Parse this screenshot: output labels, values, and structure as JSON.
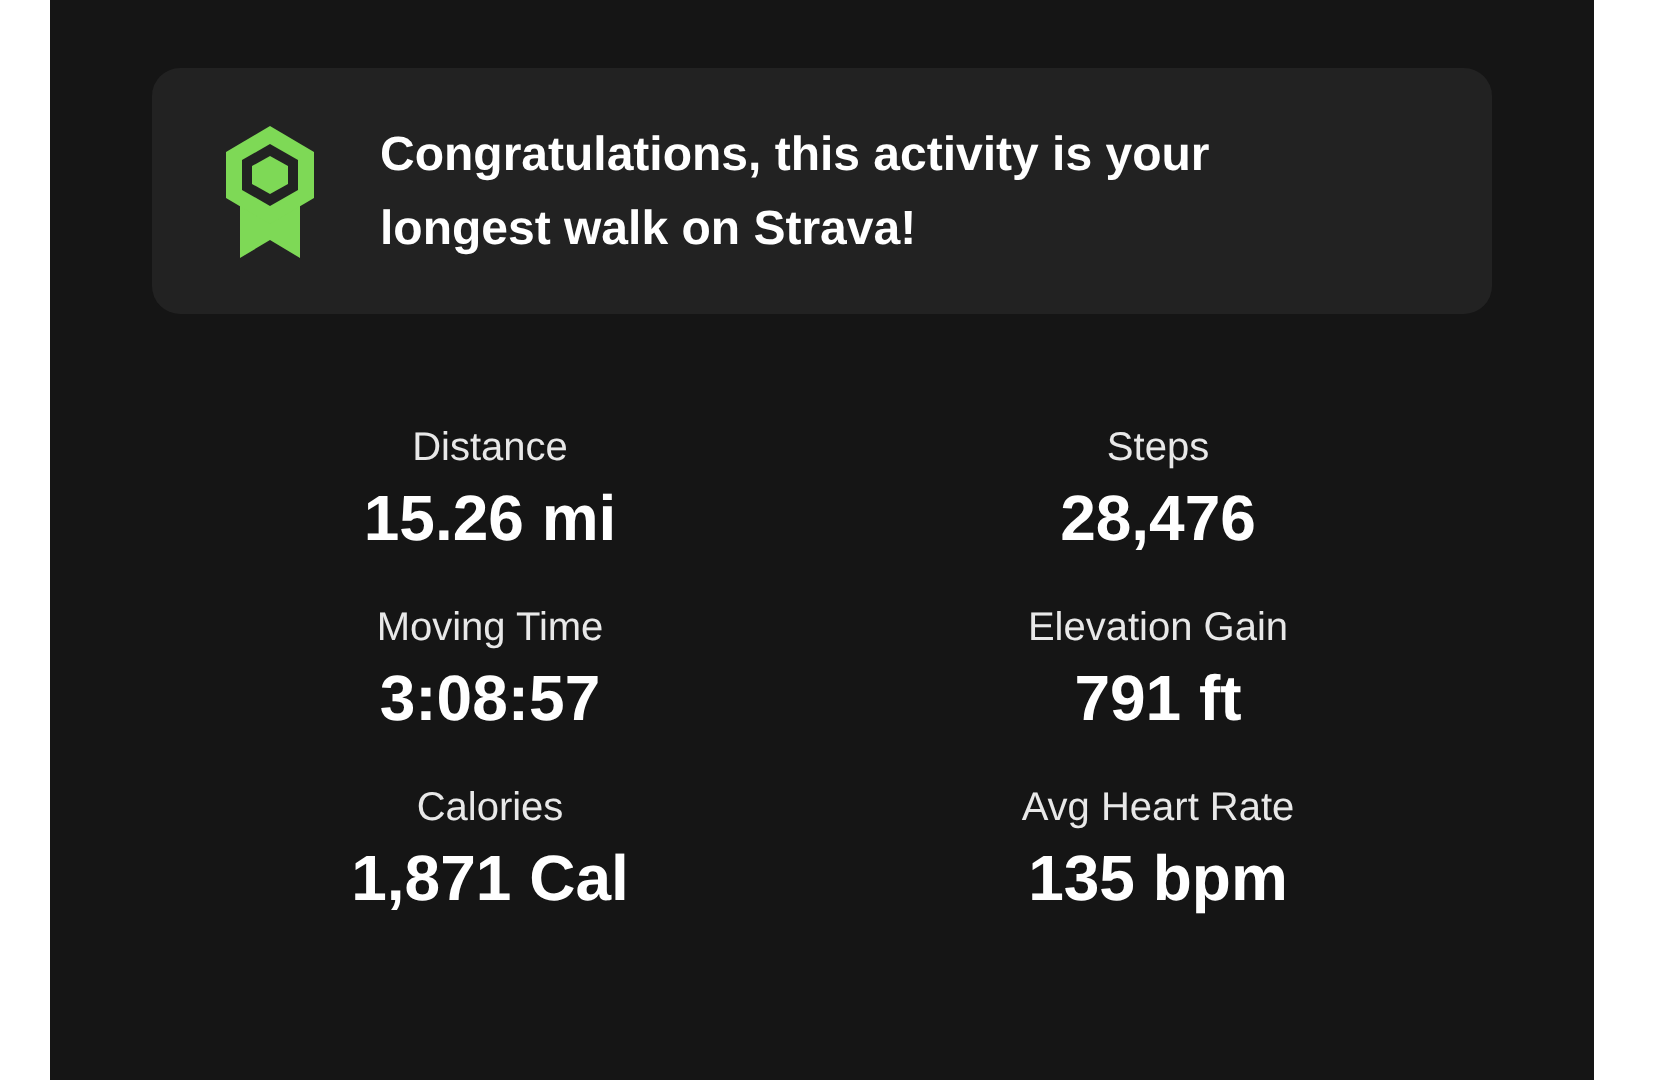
{
  "banner": {
    "message": "Congratulations, this activity is your longest walk on Strava!"
  },
  "stats": [
    {
      "label": "Distance",
      "value": "15.26 mi"
    },
    {
      "label": "Steps",
      "value": "28,476"
    },
    {
      "label": "Moving Time",
      "value": "3:08:57"
    },
    {
      "label": "Elevation Gain",
      "value": "791 ft"
    },
    {
      "label": "Calories",
      "value": "1,871 Cal"
    },
    {
      "label": "Avg Heart Rate",
      "value": "135 bpm"
    }
  ]
}
